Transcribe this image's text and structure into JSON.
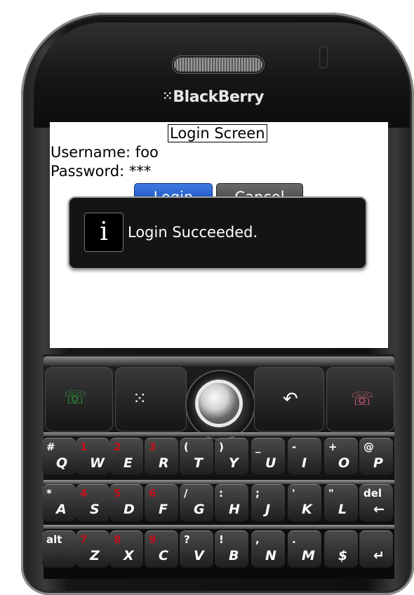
{
  "device": {
    "brand": "BlackBerry",
    "logo_glyph": "⁙"
  },
  "screen": {
    "title": "Login Screen",
    "username_label": "Username: foo",
    "password_label": "Password: ***",
    "login_button": "Login",
    "cancel_button": "Cancel",
    "dialog": {
      "icon_glyph": "i",
      "message": "Login Succeeded."
    }
  },
  "nav_keys": {
    "call_glyph": "☏",
    "menu_glyph": "⁙",
    "back_glyph": "↶",
    "end_glyph": "☏"
  },
  "keyboard": {
    "row1": [
      {
        "alt": "#",
        "main": "Q",
        "red": false
      },
      {
        "alt": "1",
        "main": "W",
        "red": true
      },
      {
        "alt": "2",
        "main": "E",
        "red": true
      },
      {
        "alt": "3",
        "main": "R",
        "red": true
      },
      {
        "alt": "(",
        "main": "T",
        "red": false
      },
      {
        "alt": ")",
        "main": "Y",
        "red": false
      },
      {
        "alt": "_",
        "main": "U",
        "red": false
      },
      {
        "alt": "-",
        "main": "I",
        "red": false
      },
      {
        "alt": "+",
        "main": "O",
        "red": false
      },
      {
        "alt": "@",
        "main": "P",
        "red": false
      }
    ],
    "row2": [
      {
        "alt": "*",
        "main": "A",
        "red": false
      },
      {
        "alt": "4",
        "main": "S",
        "red": true
      },
      {
        "alt": "5",
        "main": "D",
        "red": true
      },
      {
        "alt": "6",
        "main": "F",
        "red": true
      },
      {
        "alt": "/",
        "main": "G",
        "red": false
      },
      {
        "alt": ":",
        "main": "H",
        "red": false
      },
      {
        "alt": ";",
        "main": "J",
        "red": false
      },
      {
        "alt": "'",
        "main": "K",
        "red": false
      },
      {
        "alt": "\"",
        "main": "L",
        "red": false
      },
      {
        "alt": "del",
        "main": "←",
        "red": false
      }
    ],
    "row3": [
      {
        "alt": "alt",
        "main": "",
        "red": false
      },
      {
        "alt": "7",
        "main": "Z",
        "red": true
      },
      {
        "alt": "8",
        "main": "X",
        "red": true
      },
      {
        "alt": "9",
        "main": "C",
        "red": true
      },
      {
        "alt": "?",
        "main": "V",
        "red": false
      },
      {
        "alt": "!",
        "main": "B",
        "red": false
      },
      {
        "alt": ",",
        "main": "N",
        "red": false
      },
      {
        "alt": ".",
        "main": "M",
        "red": false
      },
      {
        "alt": "",
        "main": "$",
        "red": false
      },
      {
        "alt": "",
        "main": "↵",
        "red": false
      }
    ]
  },
  "colors": {
    "login_button": "#1a56c8",
    "dialog_bg": "#141414",
    "call_green": "#2f9a3a",
    "end_red": "#d0607a",
    "alt_number_red": "#c0121d"
  }
}
